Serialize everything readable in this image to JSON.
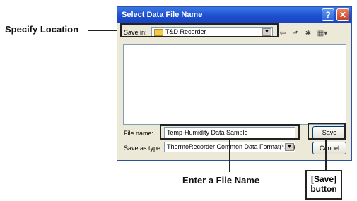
{
  "annotations": {
    "specify_location": "Specify Location",
    "enter_file_name": "Enter a File Name",
    "save_button_line1": "[Save]",
    "save_button_line2": "button"
  },
  "dialog": {
    "title": "Select Data File Name",
    "save_in_label": "Save in:",
    "save_in_value": "T&D Recorder",
    "file_name_label": "File name:",
    "file_name_value": "Temp-Humidity Data Sample",
    "save_as_type_label": "Save as type:",
    "save_as_type_value": "ThermoRecorder Common Data Format(*.trx)",
    "save_button": "Save",
    "cancel_button": "Cancel",
    "help_glyph": "?",
    "close_glyph": "✕",
    "toolbar_icons": [
      "back-icon",
      "up-folder-icon",
      "new-folder-icon",
      "views-menu-icon"
    ]
  }
}
